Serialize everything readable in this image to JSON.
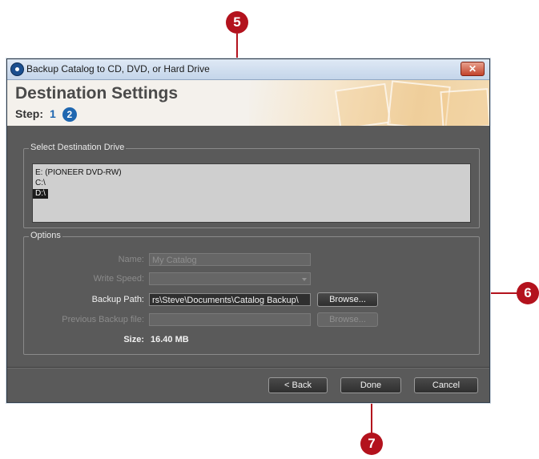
{
  "callouts": {
    "c5": "5",
    "c6": "6",
    "c7": "7"
  },
  "window": {
    "title": "Backup Catalog to CD, DVD, or Hard Drive",
    "close_label": "✕"
  },
  "header": {
    "title": "Destination Settings",
    "step_label": "Step:",
    "step1": "1",
    "step2": "2"
  },
  "drive_group": {
    "label": "Select Destination Drive",
    "items": [
      "E: (PIONEER DVD-RW)",
      "C:\\",
      "D:\\"
    ],
    "selected": "D:\\"
  },
  "options": {
    "label": "Options",
    "name_label": "Name:",
    "name_value": "My Catalog",
    "write_speed_label": "Write Speed:",
    "write_speed_value": "",
    "backup_path_label": "Backup Path:",
    "backup_path_value": "rs\\Steve\\Documents\\Catalog Backup\\",
    "browse_label": "Browse...",
    "prev_backup_label": "Previous Backup file:",
    "prev_backup_value": "",
    "browse2_label": "Browse...",
    "size_label": "Size:",
    "size_value": "16.40 MB"
  },
  "footer": {
    "back_label": "< Back",
    "done_label": "Done",
    "cancel_label": "Cancel"
  },
  "colors": {
    "callout": "#b3121d",
    "accent": "#1f67b0",
    "dialog_bg": "#5a5a5a"
  }
}
